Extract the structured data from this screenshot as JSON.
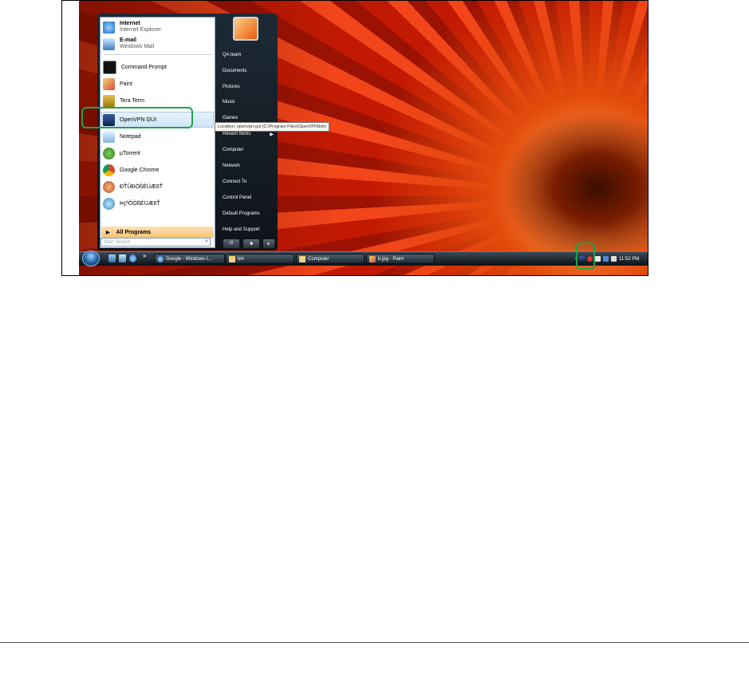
{
  "start_menu": {
    "pinned": [
      {
        "title": "Internet",
        "subtitle": "Internet Explorer"
      },
      {
        "title": "E-mail",
        "subtitle": "Windows Mail"
      }
    ],
    "programs": [
      "Command Prompt",
      "Paint",
      "Tera Term",
      "OpenVPN GUI",
      "Notepad",
      "µTorrent",
      "Google Chrome",
      "ÐŤÛÐÒßÉÚÆ6Ť",
      "ÞçªÔÒßÉÚÆ6Ť"
    ],
    "all_programs_label": "All Programs",
    "search_placeholder": "Start Search",
    "right_items": [
      "QA team",
      "Documents",
      "Pictures",
      "Music",
      "Games",
      "Recent Items",
      "Computer",
      "Network",
      "Connect To",
      "Control Panel",
      "Default Programs",
      "Help and Support"
    ],
    "tooltip": "Location: openvpn-gui (C:\\Program Files\\OpenVPN\\bin)"
  },
  "taskbar": {
    "quick_launch_more": "»",
    "tasks": [
      "Google - Windows I...",
      "bin",
      "Computer",
      "b.jpg - Paint"
    ],
    "clock": "11:52 PM"
  },
  "colors": {
    "highlight_ring": "#1fa34a",
    "menu_dark": "#1d2a36",
    "all_programs": "#f8c376"
  }
}
